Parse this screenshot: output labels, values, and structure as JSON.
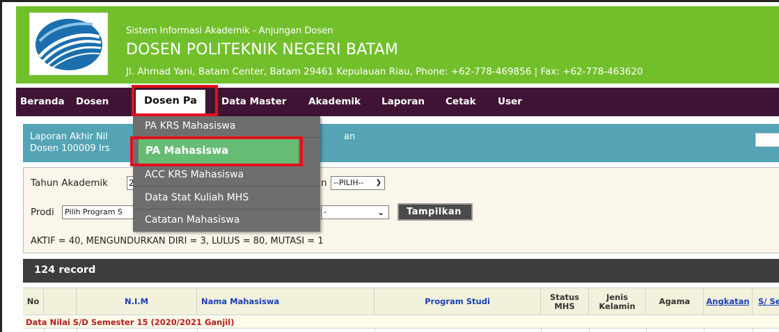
{
  "header": {
    "subtitle": "Sistem Informasi Akademik - Anjungan Dosen",
    "title": "DOSEN POLITEKNIK NEGERI BATAM",
    "address": "Jl. Ahmad Yani, Batam Center, Batam 29461 Kepulauan Riau, Phone: +62-778-469856 | Fax: +62-778-463620"
  },
  "nav": {
    "items": [
      "Beranda",
      "Dosen",
      "Dosen Pa",
      "Data Master",
      "Akademik",
      "Laporan",
      "Cetak",
      "User"
    ],
    "active": "Dosen Pa"
  },
  "dropdown": {
    "items": [
      "PA KRS Mahasiswa",
      "PA Mahasiswa",
      "ACC KRS Mahasiswa",
      "Data Stat Kuliah MHS",
      "Catatan Mahasiswa"
    ],
    "highlighted": "PA Mahasiswa"
  },
  "infobar": {
    "line1": "Laporan Akhir Nil",
    "line1_suffix": "an",
    "line2": "Dosen 100009 Irs"
  },
  "filter": {
    "tahun_label": "Tahun Akademik",
    "tahun_value": "2",
    "pilih_label_suffix": "n",
    "pilih_value": "--PILIH--",
    "prodi_label": "Prodi",
    "prodi_value": "Pilih Program S",
    "prodi_value_tail": "-",
    "show_button": "Tampilkan",
    "summary": "AKTIF = 40, MENGUNDURKAN DIRI = 3, LULUS = 80, MUTASI = 1"
  },
  "records": {
    "label": "124 record"
  },
  "table": {
    "headers": [
      "No",
      "",
      "N.I.M",
      "Nama Mahasiswa",
      "Program Studi",
      "Status MHS",
      "Jenis Kelamin",
      "Agama",
      "Angkatan",
      "S/ Se"
    ],
    "group_label": "Data Nilai S/D Semester 15 (2020/2021 Ganjil)"
  },
  "colors": {
    "header_green": "#72bf2c",
    "nav_bg": "#3f1333",
    "highlight_red": "#e3101b",
    "dropdown_green": "#67bc74",
    "info_teal": "#54a4b5"
  }
}
